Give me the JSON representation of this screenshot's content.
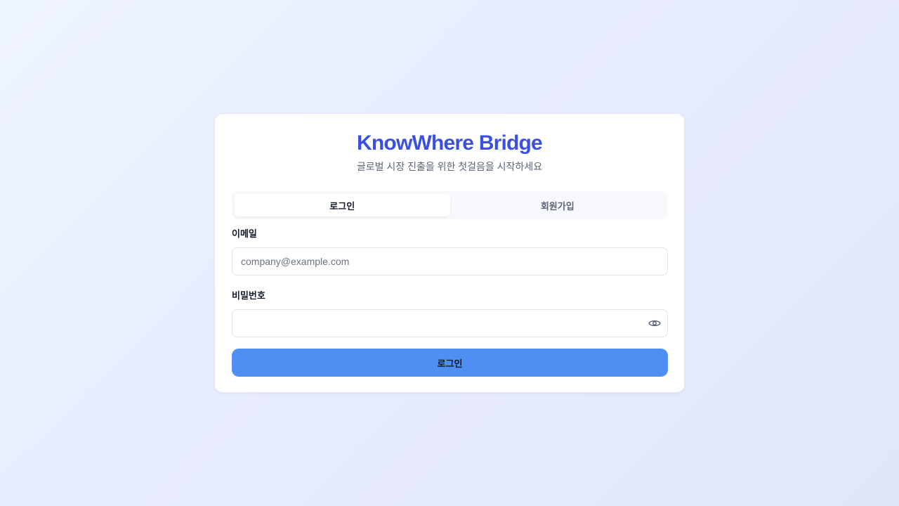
{
  "app": {
    "title": "KnowWhere Bridge",
    "subtitle": "글로벌 시장 진출을 위한 첫걸음을 시작하세요"
  },
  "tabs": [
    {
      "label": "로그인",
      "active": true
    },
    {
      "label": "회원가입",
      "active": false
    }
  ],
  "form": {
    "email_label": "이메일",
    "email_placeholder": "company@example.com",
    "email_value": "",
    "password_label": "비밀번호",
    "password_value": "",
    "password_toggle_icon": "eye-icon",
    "submit_label": "로그인"
  },
  "colors": {
    "brand": "#3b50e0",
    "primary_button": "#4f8ff3"
  }
}
